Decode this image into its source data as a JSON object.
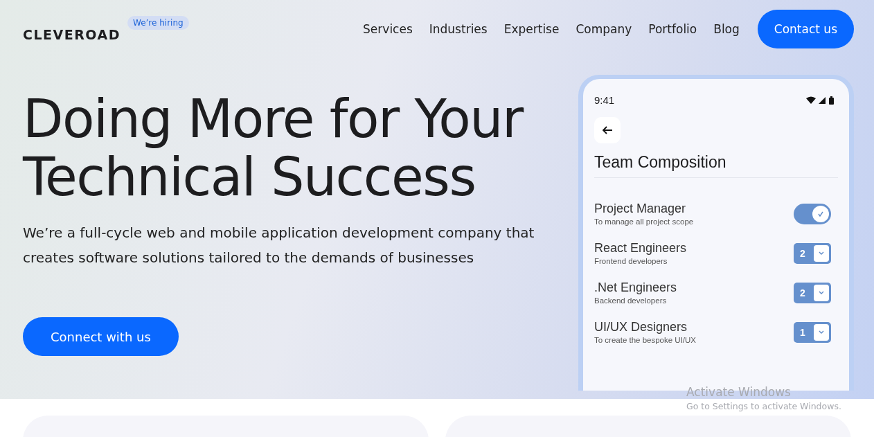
{
  "header": {
    "logo": "CLEVEROAD",
    "badge": "We’re hiring",
    "nav": [
      "Services",
      "Industries",
      "Expertise",
      "Company",
      "Portfolio",
      "Blog"
    ],
    "cta": "Contact us"
  },
  "hero": {
    "title_lines": [
      "Doing More for Your",
      "Technical Success"
    ],
    "subtitle": "We’re a full-cycle web and mobile application development company that creates software solutions tailored to the demands of businesses",
    "button": "Connect with us"
  },
  "phone": {
    "time": "9:41",
    "title": "Team Composition",
    "rows": [
      {
        "kind": "toggle",
        "name": "Project Manager",
        "note": "To manage all project scope",
        "on": true
      },
      {
        "kind": "select",
        "name": "React Engineers",
        "note": "Frontend developers",
        "value": "2"
      },
      {
        "kind": "select",
        "name": ".Net Engineers",
        "note": "Backend developers",
        "value": "2"
      },
      {
        "kind": "select",
        "name": "UI/UX Designers",
        "note": "To create the bespoke UI/UX",
        "value": "1"
      }
    ]
  },
  "os_overlay": {
    "title": "Activate Windows",
    "message": "Go to Settings to activate Windows."
  }
}
